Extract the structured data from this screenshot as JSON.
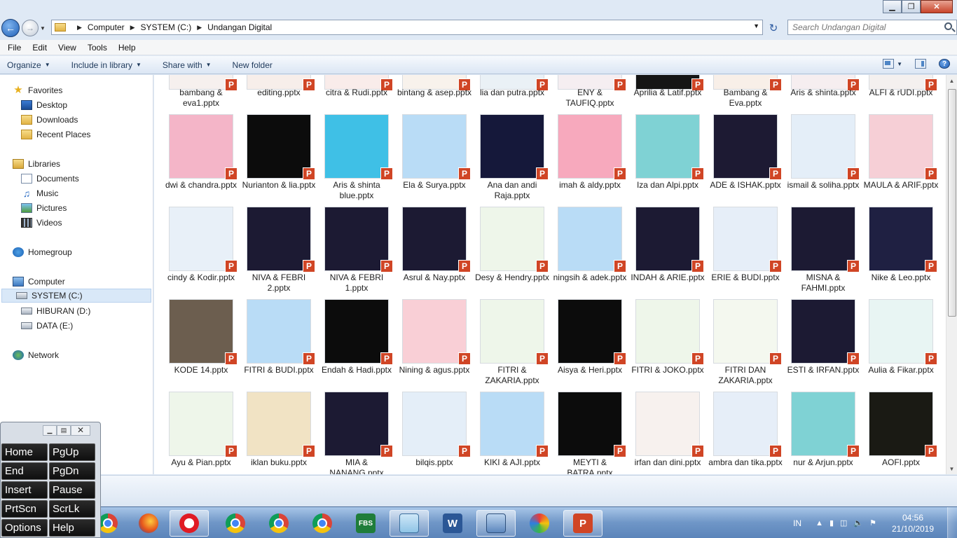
{
  "window": {
    "minimize_label": "▁",
    "maximize_label": "❐",
    "close_label": "✕"
  },
  "address": {
    "crumbs": [
      "Computer",
      "SYSTEM (C:)",
      "Undangan Digital"
    ],
    "search_placeholder": "Search Undangan Digital"
  },
  "menu": [
    "File",
    "Edit",
    "View",
    "Tools",
    "Help"
  ],
  "toolbar": {
    "organize": "Organize",
    "include": "Include in library",
    "share": "Share with",
    "new_folder": "New folder"
  },
  "nav": {
    "favorites": "Favorites",
    "desktop": "Desktop",
    "downloads": "Downloads",
    "recent": "Recent Places",
    "libraries": "Libraries",
    "documents": "Documents",
    "music": "Music",
    "pictures": "Pictures",
    "videos": "Videos",
    "homegroup": "Homegroup",
    "computer": "Computer",
    "system_c": "SYSTEM (C:)",
    "hiburan_d": "HIBURAN (D:)",
    "data_e": "DATA (E:)",
    "network": "Network"
  },
  "files": [
    [
      "bambang & eva1.pptx",
      "editing.pptx",
      "citra & Rudi.pptx",
      "bintang & asep.pptx",
      "lia dan putra.pptx",
      "ENY & TAUFIQ.pptx",
      "Aprilia & Latif.pptx",
      "Bambang & Eva.pptx",
      "Aris & shinta.pptx",
      "ALFI & rUDI.pptx"
    ],
    [
      "dwi & chandra.pptx",
      "Nurianton & lia.pptx",
      "Aris & shinta blue.pptx",
      "Ela & Surya.pptx",
      "Ana dan andi Raja.pptx",
      "imah & aldy.pptx",
      "Iza dan Alpi.pptx",
      "ADE & ISHAK.pptx",
      "ismail & soliha.pptx",
      "MAULA & ARIF.pptx"
    ],
    [
      "cindy & Kodir.pptx",
      "NIVA & FEBRI 2.pptx",
      "NIVA & FEBRI 1.pptx",
      "Asrul & Nay.pptx",
      "Desy & Hendry.pptx",
      "ningsih & adek.pptx",
      "INDAH & ARIE.pptx",
      "ERIE & BUDI.pptx",
      "MISNA & FAHMI.pptx",
      "Nike & Leo.pptx"
    ],
    [
      "KODE 14.pptx",
      "FITRI & BUDI.pptx",
      "Endah & Hadi.pptx",
      "Nining & agus.pptx",
      "FITRI & ZAKARIA.pptx",
      "Aisya & Heri.pptx",
      "FITRI & JOKO.pptx",
      "FITRI DAN ZAKARIA.pptx",
      "ESTI & IRFAN.pptx",
      "Aulia & Fikar.pptx"
    ],
    [
      "Ayu & Pian.pptx",
      "iklan buku.pptx",
      "MIA & NANANG.pptx",
      "bilqis.pptx",
      "KIKI & AJI.pptx",
      "MEYTI & BATRA.pptx",
      "irfan dan dini.pptx",
      "ambra dan tika.pptx",
      "nur & Arjun.pptx",
      "AOFI.pptx"
    ]
  ],
  "thumb_colors": [
    [
      "#f6f0ee",
      "#f7eeea",
      "#f9ecea",
      "#f8f2ec",
      "#eaf1f6",
      "#f5eef1",
      "#151515",
      "#f8efe8",
      "#f6eef0",
      "#f4f0ef"
    ],
    [
      "#f4b5c8",
      "#0c0c0c",
      "#3fc0e6",
      "#b9dcf6",
      "#15183a",
      "#f7a9bd",
      "#7fd2d4",
      "#1d1a33",
      "#e4eef8",
      "#f6cfd6"
    ],
    [
      "#e8f0f8",
      "#1c1a33",
      "#1c1a33",
      "#1c1a33",
      "#eef6ea",
      "#b9dcf6",
      "#1c1a33",
      "#e6eef8",
      "#1c1a33",
      "#1f2042"
    ],
    [
      "#6c5e4f",
      "#b9dcf6",
      "#0c0c0c",
      "#f9cfd6",
      "#eef6ea",
      "#0c0c0c",
      "#eef6ea",
      "#f4f8ef",
      "#1c1a33",
      "#e8f5f3"
    ],
    [
      "#eef6ea",
      "#f1e3c4",
      "#1c1a33",
      "#e4eef8",
      "#b9dcf6",
      "#0c0c0c",
      "#f7f1ee",
      "#e6eef8",
      "#7fd2d4",
      "#1a1a14"
    ]
  ],
  "ppt_badge": "P",
  "taskbar": {
    "tray_lang": "IN",
    "time": "04:56",
    "date": "21/10/2019",
    "fbs_label": "FBS",
    "word_label": "W",
    "ppt_label": "P"
  },
  "osk": {
    "keys": [
      "Home",
      "PgUp",
      "End",
      "PgDn",
      "Insert",
      "Pause",
      "PrtScn",
      "ScrLk",
      "Options",
      "Help"
    ]
  }
}
